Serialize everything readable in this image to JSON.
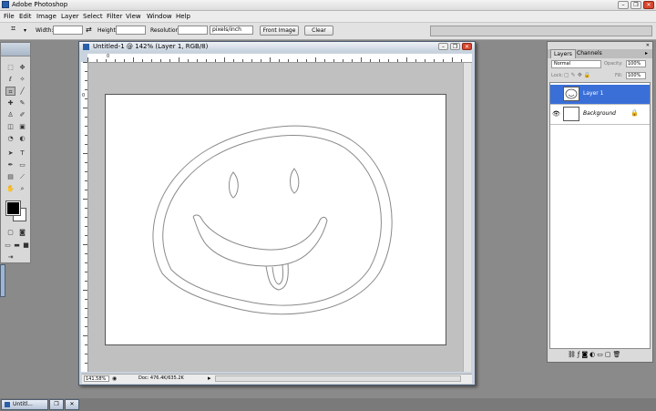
{
  "app": {
    "title": "Adobe Photoshop"
  },
  "window_buttons": [
    "–",
    "❐",
    "✕"
  ],
  "menu": [
    "File",
    "Edit",
    "Image",
    "Layer",
    "Select",
    "Filter",
    "View",
    "Window",
    "Help"
  ],
  "options": {
    "width_label": "Width:",
    "height_label": "Height:",
    "resolution_label": "Resolution:",
    "units": "pixels/inch",
    "front_image": "Front Image",
    "clear": "Clear"
  },
  "document": {
    "title": "Untitled-1 @ 142% (Layer 1, RGB/8)",
    "zoom": "141.58%",
    "doc_info": "Doc: 476.4K/635.2K",
    "ruler_labels": [
      "0",
      "0"
    ]
  },
  "layers_panel": {
    "tabs": [
      "Layers",
      "Channels"
    ],
    "blend_mode": "Normal",
    "opacity_label": "Opacity:",
    "opacity_value": "100%",
    "lock_label": "Lock:",
    "fill_label": "Fill:",
    "fill_value": "100%",
    "layers": [
      {
        "name": "Layer 1",
        "selected": true
      },
      {
        "name": "Background",
        "selected": false
      }
    ]
  },
  "taskbar": {
    "items": [
      "Untitl..."
    ]
  },
  "colors": {
    "selection": "#3a6fd8",
    "foreground": "#000000",
    "background": "#ffffff"
  }
}
